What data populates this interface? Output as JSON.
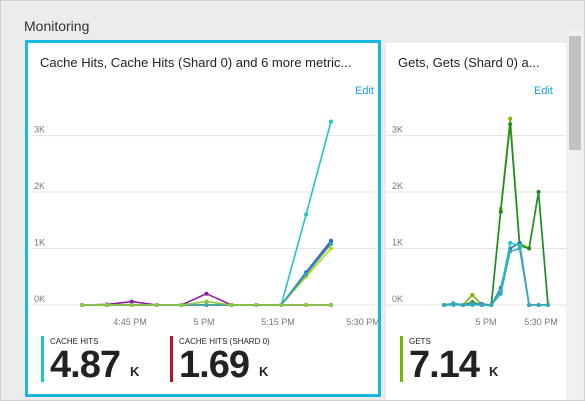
{
  "section": {
    "title": "Monitoring"
  },
  "tiles": [
    {
      "title": "Cache Hits, Cache Hits (Shard 0) and 6 more metric...",
      "edit": "Edit",
      "y_ticks": [
        "3K",
        "2K",
        "1K",
        "0K"
      ],
      "x_ticks": [
        "4:45 PM",
        "5 PM",
        "5:15 PM",
        "5:30 PM"
      ],
      "metrics": [
        {
          "label": "CACHE HITS",
          "value": "4.87",
          "unit": "K",
          "color": "#1ac9c2"
        },
        {
          "label": "CACHE HITS (SHARD 0)",
          "value": "1.69",
          "unit": "K",
          "color": "#b5152b"
        }
      ]
    },
    {
      "title": "Gets, Gets (Shard 0) a...",
      "edit": "Edit",
      "y_ticks": [
        "3K",
        "2K",
        "1K",
        "0K"
      ],
      "x_ticks": [
        "5 PM",
        "5:30 PM"
      ],
      "metrics": [
        {
          "label": "GETS",
          "value": "7.14",
          "unit": "K",
          "color": "#7ab800"
        }
      ]
    }
  ],
  "chart_data": [
    {
      "type": "line",
      "title": "Cache Hits, Cache Hits (Shard 0) and 6 more metric...",
      "x": [
        "4:34 PM",
        "4:39 PM",
        "4:44 PM",
        "4:49 PM",
        "4:55 PM",
        "5:00 PM",
        "5:05 PM",
        "5:10 PM",
        "5:15 PM",
        "5:21 PM",
        "5:26 PM"
      ],
      "ylim": [
        0,
        3400
      ],
      "series": [
        {
          "name": "Cache Hits",
          "color": "#1ac9c2",
          "values": [
            0,
            0,
            0,
            0,
            0,
            0,
            0,
            0,
            0,
            1600,
            3250
          ]
        },
        {
          "name": "Cache Hits (Shard 0)",
          "color": "#b5152b",
          "values": [
            0,
            0,
            0,
            0,
            0,
            0,
            0,
            0,
            0,
            560,
            1120
          ]
        },
        {
          "color": "#8e1b9e",
          "values": [
            0,
            10,
            60,
            0,
            0,
            200,
            0,
            0,
            0,
            0,
            0
          ]
        },
        {
          "color": "#2e6fc7",
          "values": [
            0,
            0,
            0,
            0,
            0,
            0,
            0,
            0,
            0,
            580,
            1140
          ]
        },
        {
          "color": "#c7d800",
          "values": [
            0,
            0,
            0,
            0,
            0,
            0,
            0,
            0,
            0,
            500,
            1000
          ]
        },
        {
          "color": "#5e9b2f",
          "values": [
            0,
            0,
            0,
            0,
            0,
            0,
            0,
            0,
            0,
            0,
            0
          ]
        },
        {
          "color": "#3aa6b9",
          "values": [
            0,
            0,
            0,
            0,
            0,
            0,
            0,
            0,
            0,
            540,
            1080
          ]
        },
        {
          "color": "#8dc63f",
          "values": [
            0,
            0,
            0,
            0,
            0,
            60,
            0,
            0,
            0,
            0,
            0
          ]
        }
      ]
    },
    {
      "type": "line",
      "title": "Gets, Gets (Shard 0) a...",
      "x": [
        "5:05 PM",
        "5:08 PM",
        "5:11 PM",
        "5:14 PM",
        "5:17 PM",
        "5:20 PM",
        "5:24 PM",
        "5:26 PM",
        "5:28 PM",
        "5:30 PM",
        "5:32 PM",
        "5:34 PM"
      ],
      "ylim": [
        0,
        3400
      ],
      "series": [
        {
          "name": "Gets",
          "color": "#7ab800",
          "values": [
            0,
            20,
            0,
            180,
            0,
            0,
            1700,
            3300,
            1100,
            1000,
            2000,
            0
          ]
        },
        {
          "color": "#1e8c2e",
          "values": [
            0,
            10,
            0,
            50,
            0,
            0,
            1650,
            3200,
            1050,
            1000,
            2000,
            0
          ]
        },
        {
          "color": "#2e6fc7",
          "values": [
            0,
            30,
            0,
            0,
            20,
            0,
            300,
            1000,
            1100,
            0,
            0,
            0
          ]
        },
        {
          "color": "#1ac9c2",
          "values": [
            0,
            20,
            0,
            0,
            0,
            0,
            250,
            1100,
            1050,
            0,
            0,
            0
          ]
        },
        {
          "color": "#3aa6b9",
          "values": [
            0,
            0,
            0,
            20,
            0,
            0,
            200,
            950,
            1000,
            0,
            0,
            0
          ]
        }
      ]
    }
  ]
}
